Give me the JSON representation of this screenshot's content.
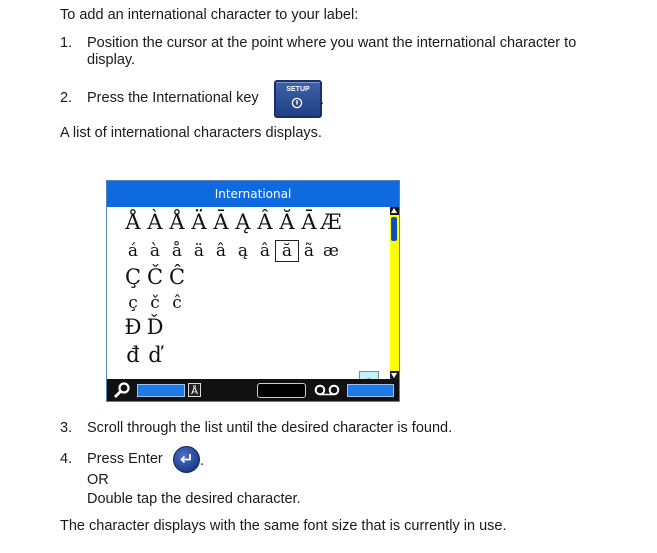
{
  "intro": "To add an international character to your label:",
  "steps": [
    {
      "num": "1.",
      "line1": "Position the cursor at the point where you want the international character to",
      "line2": "display."
    },
    {
      "num": "2.",
      "text": "Press the International key",
      "key_label": "SETUP",
      "after": "."
    },
    {
      "num": "3.",
      "text": "Scroll through the list until the desired character is found."
    },
    {
      "num": "4.",
      "text": "Press Enter",
      "after": ".",
      "or": "OR",
      "alt": "Double tap the desired character."
    }
  ],
  "list_displays": "A list of international characters displays.",
  "closing": "The character displays with the same font size that is currently in use.",
  "screen": {
    "title": "International",
    "rows": [
      [
        "Å",
        "À",
        "Å",
        "Ä",
        "Ā",
        "Ą",
        "Â",
        "Ă",
        "Ā",
        "Æ"
      ],
      [
        "á",
        "à",
        "å",
        "ä",
        "â",
        "ą",
        "â",
        "ă",
        "ã",
        "æ"
      ],
      [
        "Ç",
        "Č",
        "Ĉ"
      ],
      [
        "ç",
        "č",
        "ĉ"
      ],
      [
        "Đ",
        "Ď"
      ],
      [
        "đ",
        "ď"
      ]
    ],
    "selected": "ă",
    "preview_char": "a",
    "status_icons": [
      "search-icon",
      "char-icon",
      "tape-icon"
    ]
  },
  "colors": {
    "screen_header": "#0f6ae0",
    "scrollbar": "#ffff00",
    "key_blue": "#1f3f86"
  }
}
